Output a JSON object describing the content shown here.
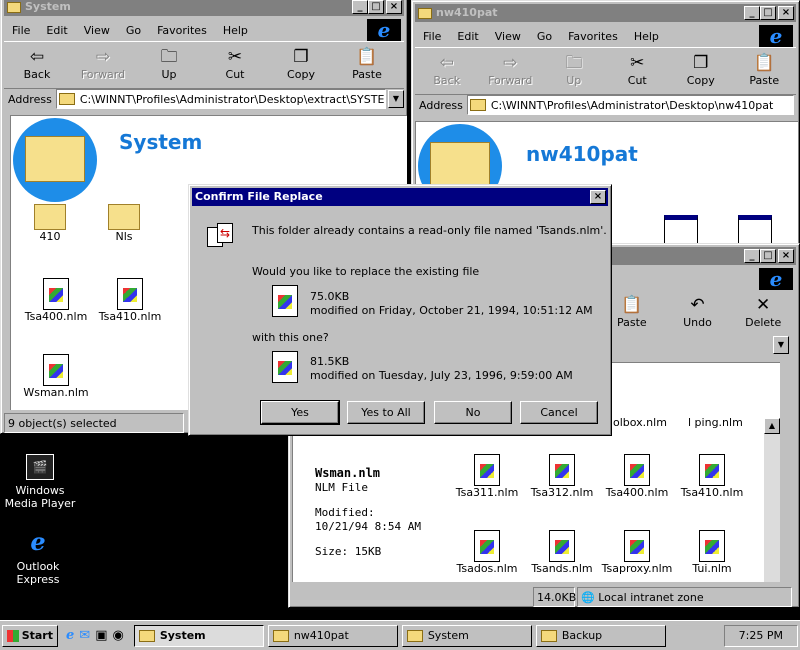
{
  "win_system": {
    "title": "System",
    "menu": [
      "File",
      "Edit",
      "View",
      "Go",
      "Favorites",
      "Help"
    ],
    "toolbar": [
      {
        "label": "Back",
        "icon": "back-arrow"
      },
      {
        "label": "Forward",
        "icon": "forward-arrow"
      },
      {
        "label": "Up",
        "icon": "up-folder"
      },
      {
        "label": "Cut",
        "icon": "scissors"
      },
      {
        "label": "Copy",
        "icon": "copy"
      },
      {
        "label": "Paste",
        "icon": "paste"
      }
    ],
    "address_label": "Address",
    "address": "C:\\WINNT\\Profiles\\Administrator\\Desktop\\extract\\SYSTEM",
    "heading": "System",
    "items": [
      "410",
      "Nls",
      "Tsa400.nlm",
      "Tsa410.nlm",
      "Wsman.nlm"
    ],
    "status": "9 object(s) selected"
  },
  "win_nw": {
    "title": "nw410pat",
    "menu": [
      "File",
      "Edit",
      "View",
      "Go",
      "Favorites",
      "Help"
    ],
    "toolbar": [
      {
        "label": "Back"
      },
      {
        "label": "Forward"
      },
      {
        "label": "Up"
      },
      {
        "label": "Cut"
      },
      {
        "label": "Copy"
      },
      {
        "label": "Paste"
      }
    ],
    "address_label": "Address",
    "address": "C:\\WINNT\\Profiles\\Administrator\\Desktop\\nw410pat",
    "heading": "nw410pat"
  },
  "win_backup": {
    "toolbar": [
      {
        "label": "Paste"
      },
      {
        "label": "Undo"
      },
      {
        "label": "Delete"
      }
    ],
    "partial_items": [
      "olbox.nlm",
      "l ping.nlm"
    ],
    "info": {
      "name": "Wsman.nlm",
      "type": "NLM File",
      "modified_label": "Modified:",
      "modified": "10/21/94 8:54 AM",
      "size": "Size: 15KB"
    },
    "items": [
      "Tsa311.nlm",
      "Tsa312.nlm",
      "Tsa400.nlm",
      "Tsa410.nlm",
      "Tsados.nlm",
      "Tsands.nlm",
      "Tsaproxy.nlm",
      "Tui.nlm"
    ],
    "status_size": "14.0KB",
    "status_zone": "Local intranet zone"
  },
  "dialog": {
    "title": "Confirm File Replace",
    "message": "This folder already contains a read-only file named 'Tsands.nlm'.",
    "question": "Would you like to replace the existing file",
    "existing": {
      "size": "75.0KB",
      "modified": "modified on Friday, October 21, 1994, 10:51:12 AM"
    },
    "with_label": "with this one?",
    "new": {
      "size": "81.5KB",
      "modified": "modified on Tuesday, July 23, 1996, 9:59:00 AM"
    },
    "buttons": [
      "Yes",
      "Yes to All",
      "No",
      "Cancel"
    ]
  },
  "desktop": [
    {
      "label": "Windows Media Player",
      "line1": "Windows",
      "line2": "Media Player"
    },
    {
      "line1": "Outlook",
      "line2": "Express"
    }
  ],
  "taskbar": {
    "start": "Start",
    "tasks": [
      "System",
      "nw410pat",
      "System",
      "Backup"
    ],
    "active": "System",
    "clock": "7:25 PM"
  },
  "colors": {
    "titlebar_active": "#000080",
    "titlebar_inactive": "#808080",
    "face": "#c0c0c0",
    "heading": "#1578d6"
  }
}
